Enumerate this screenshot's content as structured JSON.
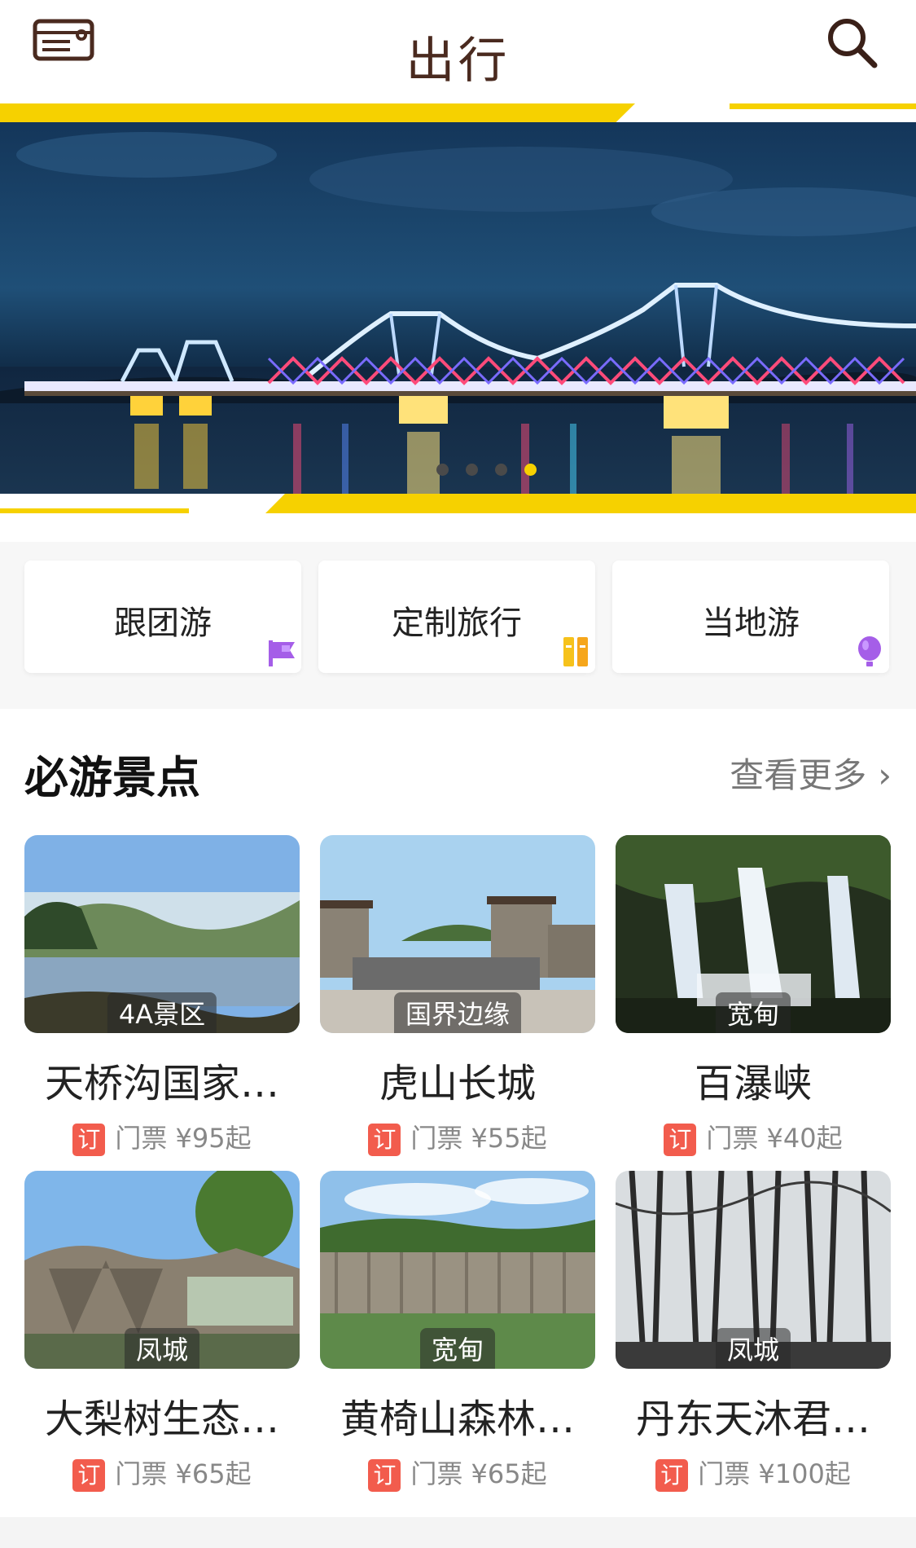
{
  "header": {
    "title": "出行",
    "left_icon": "ticket-icon",
    "right_icon": "search-icon"
  },
  "banner": {
    "image": "Illuminated bridge over river at night",
    "slide_count": 4,
    "active_slide": 4
  },
  "categories": [
    {
      "label": "跟团游",
      "icon": "flag-icon",
      "icon_color": "#a55ee8"
    },
    {
      "label": "定制旅行",
      "icon": "columns-icon",
      "icon_color": "#f6c21b"
    },
    {
      "label": "当地游",
      "icon": "balloon-icon",
      "icon_color": "#a55ee8"
    }
  ],
  "section": {
    "title": "必游景点",
    "more_label": "查看更多",
    "items": [
      {
        "name": "天桥沟国家…",
        "tag": "4A景区",
        "badge": "订",
        "price": "门票 ¥95起"
      },
      {
        "name": "虎山长城",
        "tag": "国界边缘",
        "badge": "订",
        "price": "门票 ¥55起"
      },
      {
        "name": "百瀑峡",
        "tag": "宽甸",
        "badge": "订",
        "price": "门票 ¥40起"
      },
      {
        "name": "大梨树生态…",
        "tag": "凤城",
        "badge": "订",
        "price": "门票 ¥65起"
      },
      {
        "name": "黄椅山森林…",
        "tag": "宽甸",
        "badge": "订",
        "price": "门票 ¥65起"
      },
      {
        "name": "丹东天沐君…",
        "tag": "凤城",
        "badge": "订",
        "price": "门票 ¥100起"
      }
    ]
  },
  "colors": {
    "accent_yellow": "#f6d100",
    "badge_red": "#f25c4d",
    "title_brown": "#4a2a1f"
  }
}
